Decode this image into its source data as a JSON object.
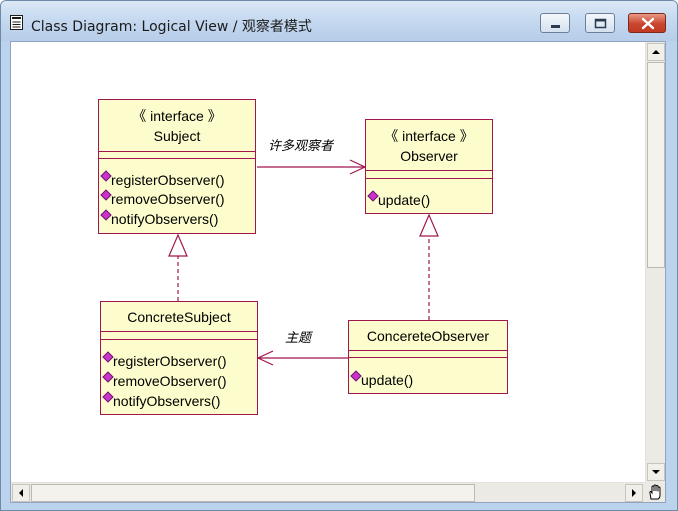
{
  "window": {
    "title": "Class Diagram: Logical View / 观察者模式"
  },
  "diagram": {
    "subject": {
      "stereotype": "《 interface 》",
      "name": "Subject",
      "operations": [
        "registerObserver()",
        "removeObserver()",
        "notifyObservers()"
      ]
    },
    "observer": {
      "stereotype": "《 interface 》",
      "name": "Observer",
      "operations": [
        "update()"
      ]
    },
    "concrete_subject": {
      "name": "ConcreteSubject",
      "operations": [
        "registerObserver()",
        "removeObserver()",
        "notifyObservers()"
      ]
    },
    "concrete_observer": {
      "name": "ConcereteObserver",
      "operations": [
        "update()"
      ]
    },
    "associations": {
      "subject_to_observer": "许多观察者",
      "observer_to_subject": "主题"
    }
  },
  "icons": {
    "title": "document-icon",
    "operation": "operation-diamond-icon"
  },
  "colors": {
    "class_fill": "#fdfccc",
    "class_border": "#a0164e",
    "operation_icon": "#cc33cc"
  }
}
